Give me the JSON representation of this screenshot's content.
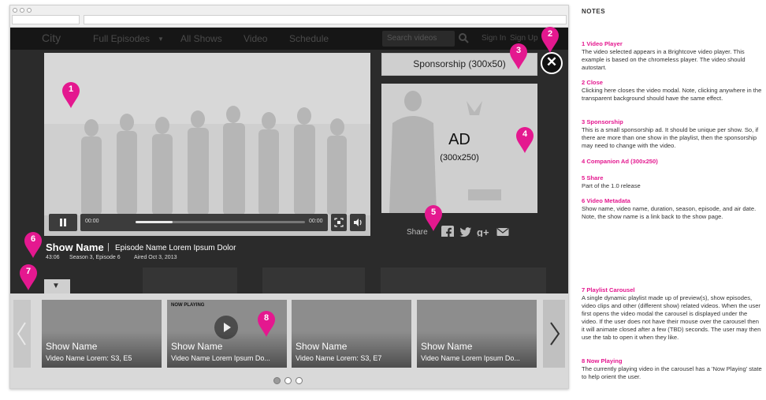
{
  "site_nav": {
    "logo": "City",
    "items": [
      "Full Episodes",
      "All Shows",
      "Video",
      "Schedule"
    ],
    "search_placeholder": "Search videos",
    "sign_in": "Sign In",
    "sign_up": "Sign Up"
  },
  "player": {
    "time_current": "00:00",
    "time_total": "00:00",
    "progress": 0.22
  },
  "sponsorship": {
    "label": "Sponsorship (300x50)"
  },
  "companion_ad": {
    "label": "AD",
    "size": "(300x250)"
  },
  "share": {
    "label": "Share"
  },
  "metadata": {
    "show_name": "Show Name",
    "separator": "|",
    "episode_name": "Episode Name Lorem Ipsum Dolor",
    "duration": "43:06",
    "season_episode": "Season 3, Episode 6",
    "air_date": "Aired Oct 3, 2013"
  },
  "carousel": {
    "cards": [
      {
        "show": "Show Name",
        "video": "Video Name Lorem: S3, E5",
        "now_playing": ""
      },
      {
        "show": "Show Name",
        "video": "Video Name Lorem Ipsum Do...",
        "now_playing": "NOW PLAYING"
      },
      {
        "show": "Show Name",
        "video": "Video Name Lorem: S3, E7",
        "now_playing": ""
      },
      {
        "show": "Show Name",
        "video": "Video Name Lorem Ipsum Do...",
        "now_playing": ""
      }
    ],
    "pages": 3,
    "active_page": 0
  },
  "pins": [
    "1",
    "2",
    "3",
    "4",
    "5",
    "6",
    "7",
    "8"
  ],
  "notes": {
    "title": "NOTES",
    "items": [
      {
        "heading": "1 Video Player",
        "body": "The video selected appears in a Brightcove video player. This example is based on the chromeless player. The video should autostart."
      },
      {
        "heading": "2 Close",
        "body": "Clicking here closes the video modal. Note, clicking anywhere in the transparent background should have the same effect."
      },
      {
        "heading": "3 Sponsorship",
        "body": "This is a small sponsorship ad. It should be unique per show. So, if there are more than one show in the playlist, then the sponsorship may need to change with the video."
      },
      {
        "heading": "4 Companion Ad (300x250)",
        "body": ""
      },
      {
        "heading": "5 Share",
        "body": "Part of the 1.0 release"
      },
      {
        "heading": "6 Video Metadata",
        "body": "Show name, video name, duration, season, episode, and air date. Note, the show name is a link back to the show page."
      },
      {
        "heading": "7 Playlist Carousel",
        "body": "A single dynamic playlist made up of preview(s), show episodes, video clips and other (different show) related videos. When the user first opens the video modal the carousel is displayed under the video. If the user does not have their mouse over the carousel then it will animate closed after a few (TBD) seconds. The user may then use the tab to open it when they like."
      },
      {
        "heading": "8 Now Playing",
        "body": "The currently playing video in the carousel has a 'Now Playing' state to help orient the user."
      }
    ]
  },
  "colors": {
    "pin": "#e4188f",
    "overlay": "#2b2b2b",
    "placeholder": "#cfcfcf"
  }
}
